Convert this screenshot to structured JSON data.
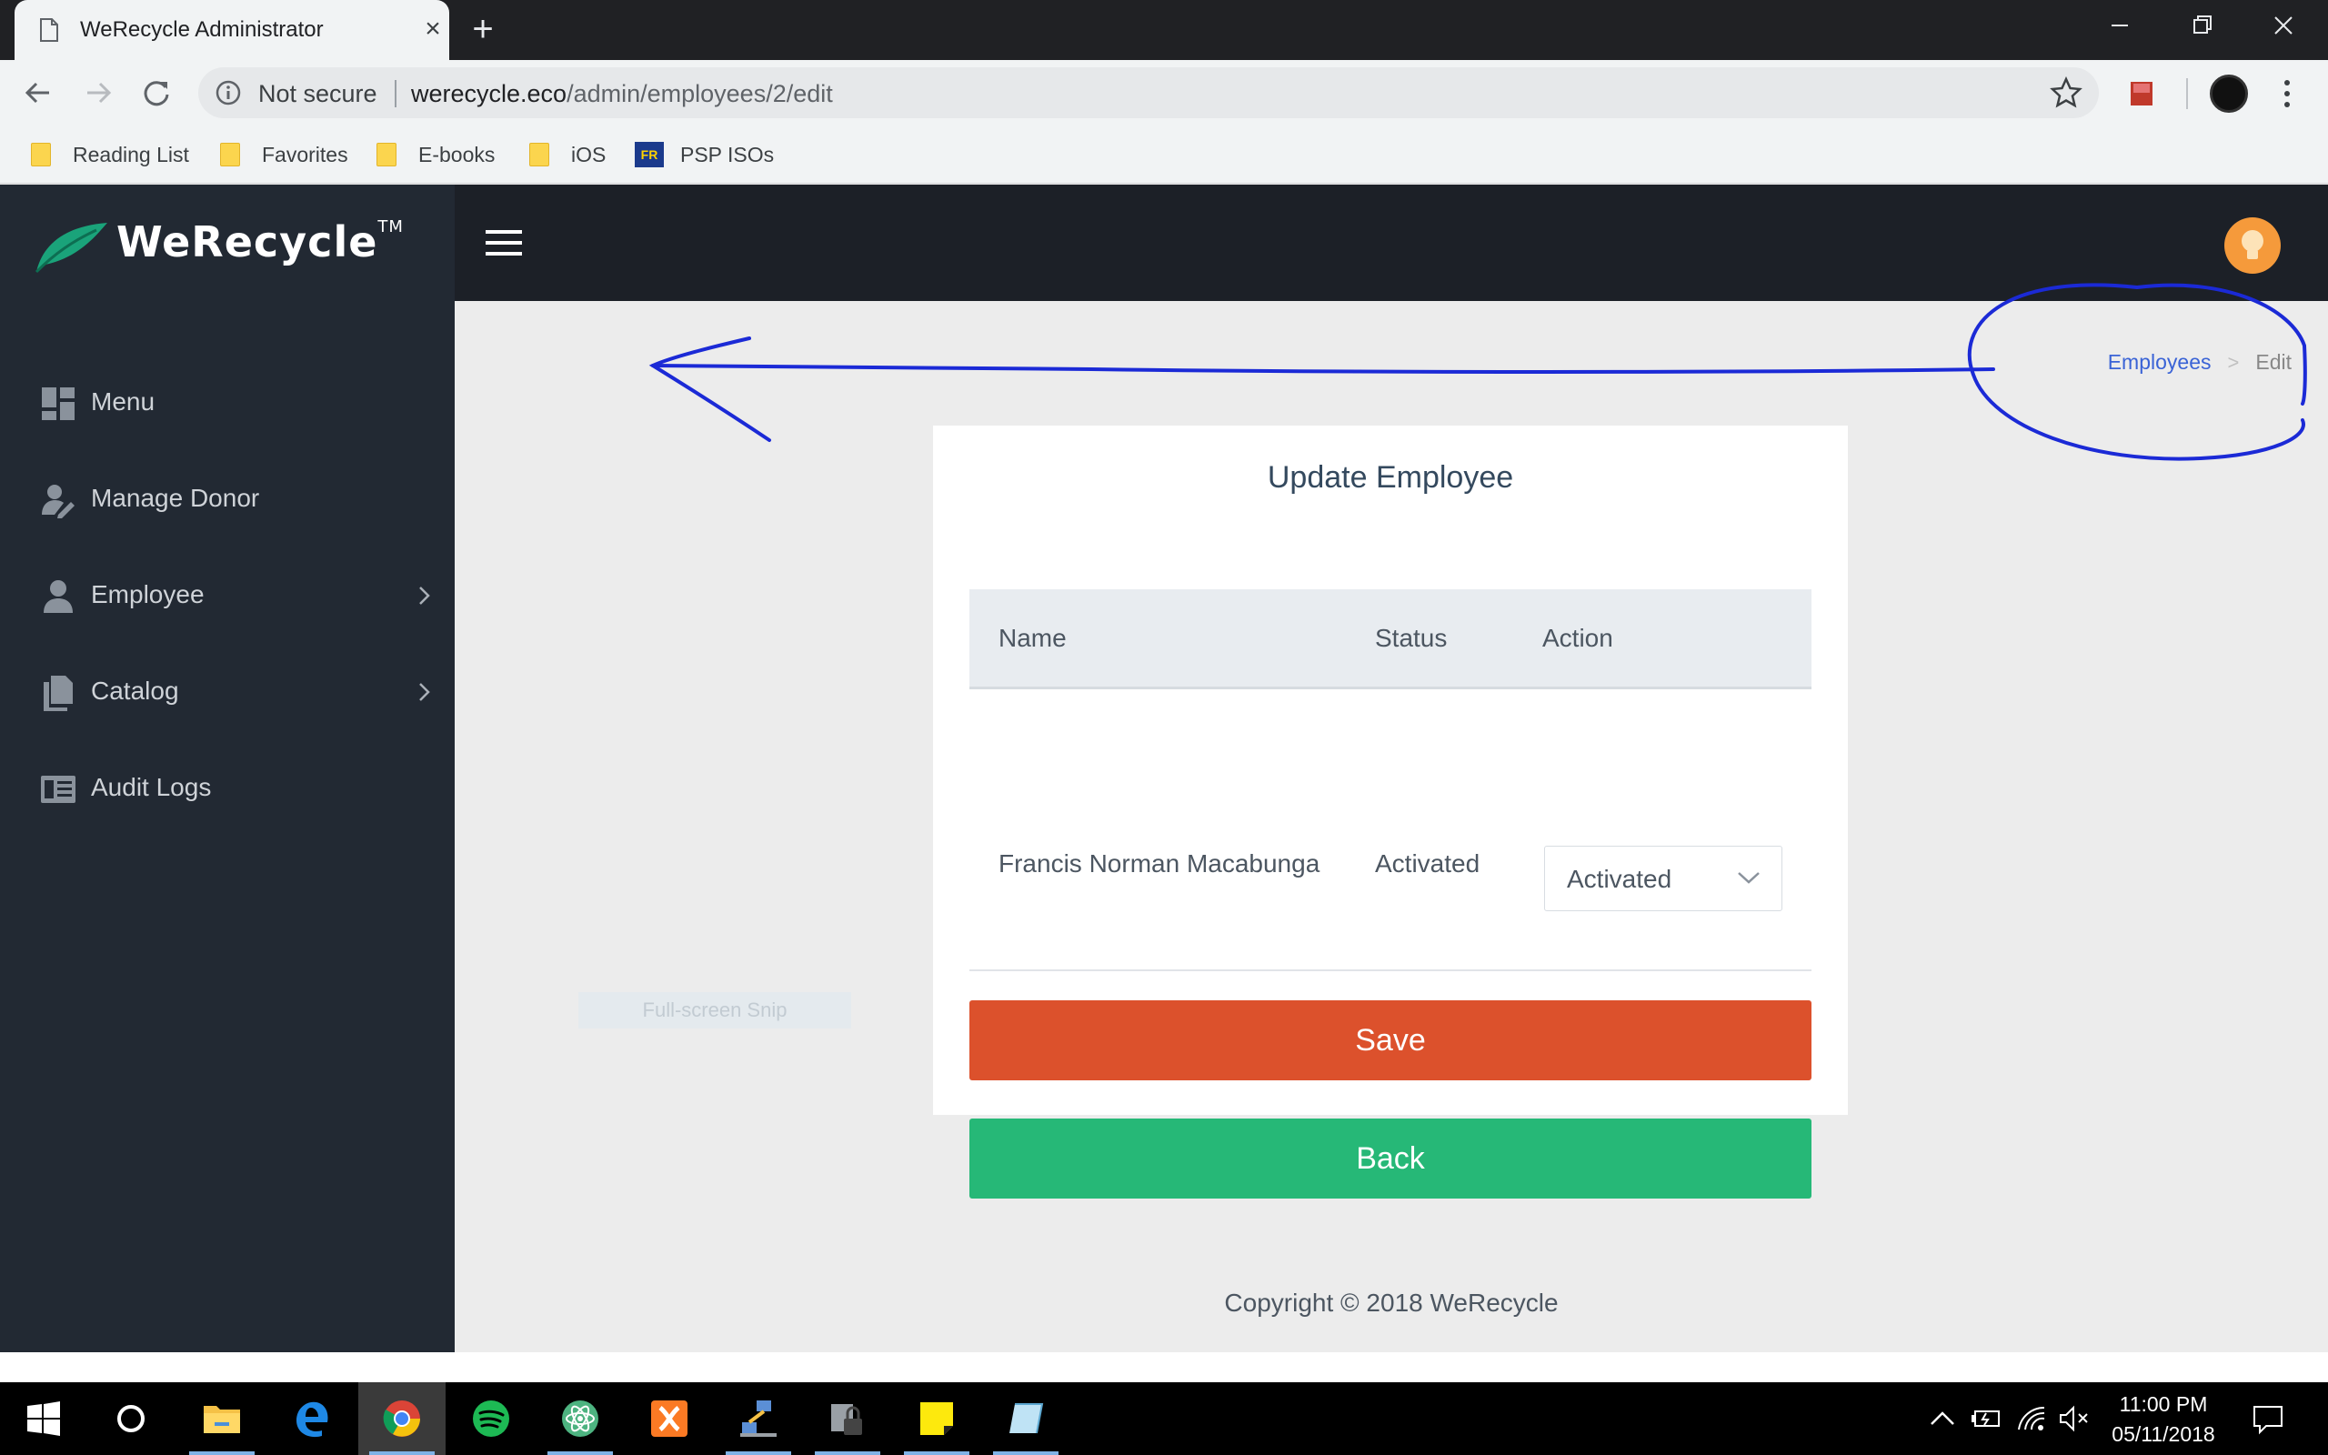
{
  "browser": {
    "tab_title": "WeRecycle Administrator",
    "tab_close": "×",
    "new_tab": "+",
    "security_label": "Not secure",
    "url_host": "werecycle.eco",
    "url_path": "/admin/employees/2/edit",
    "bookmarks": [
      {
        "label": "Reading List",
        "icon": "folder-icon"
      },
      {
        "label": "Favorites",
        "icon": "folder-icon"
      },
      {
        "label": "E-books",
        "icon": "folder-icon"
      },
      {
        "label": "iOS",
        "icon": "folder-icon"
      },
      {
        "label": "PSP ISOs",
        "icon": "fr-site-icon",
        "icon_text": "FR"
      }
    ]
  },
  "app": {
    "brand": "WeRecycle",
    "brand_tm": "TM",
    "sidebar": {
      "items": [
        {
          "label": "Menu",
          "icon": "dashboard-icon",
          "has_submenu": false
        },
        {
          "label": "Manage Donor",
          "icon": "user-edit-icon",
          "has_submenu": false
        },
        {
          "label": "Employee",
          "icon": "user-icon",
          "has_submenu": true
        },
        {
          "label": "Catalog",
          "icon": "documents-icon",
          "has_submenu": true
        },
        {
          "label": "Audit Logs",
          "icon": "logs-icon",
          "has_submenu": false
        }
      ]
    },
    "breadcrumb": {
      "items": [
        "Employees",
        "Edit"
      ],
      "separator": ">"
    },
    "card": {
      "title": "Update Employee",
      "table": {
        "columns": [
          "Name",
          "Status",
          "Action"
        ],
        "rows": [
          {
            "name": "Francis Norman Macabunga",
            "status": "Activated",
            "action_value": "Activated"
          }
        ]
      },
      "save_label": "Save",
      "back_label": "Back"
    },
    "ghost_label": "Full-screen Snip",
    "copyright": "Copyright © 2018 WeRecycle",
    "colors": {
      "sidebar": "#222933",
      "topbar": "#1c2027",
      "save": "#dc512c",
      "back": "#26b877",
      "breadcrumb_link": "#3a63d6",
      "annotation": "#1b2ad6",
      "avatar": "#f59a3b"
    }
  },
  "taskbar": {
    "apps": [
      "start-icon",
      "cortana-icon",
      "file-explorer-icon",
      "edge-icon",
      "chrome-icon",
      "spotify-icon",
      "atom-icon",
      "xampp-icon",
      "network-icon",
      "lock-icon",
      "sticky-notes-icon",
      "notepad-icon"
    ],
    "active_app": "chrome-icon",
    "time": "11:00 PM",
    "date": "05/11/2018"
  }
}
